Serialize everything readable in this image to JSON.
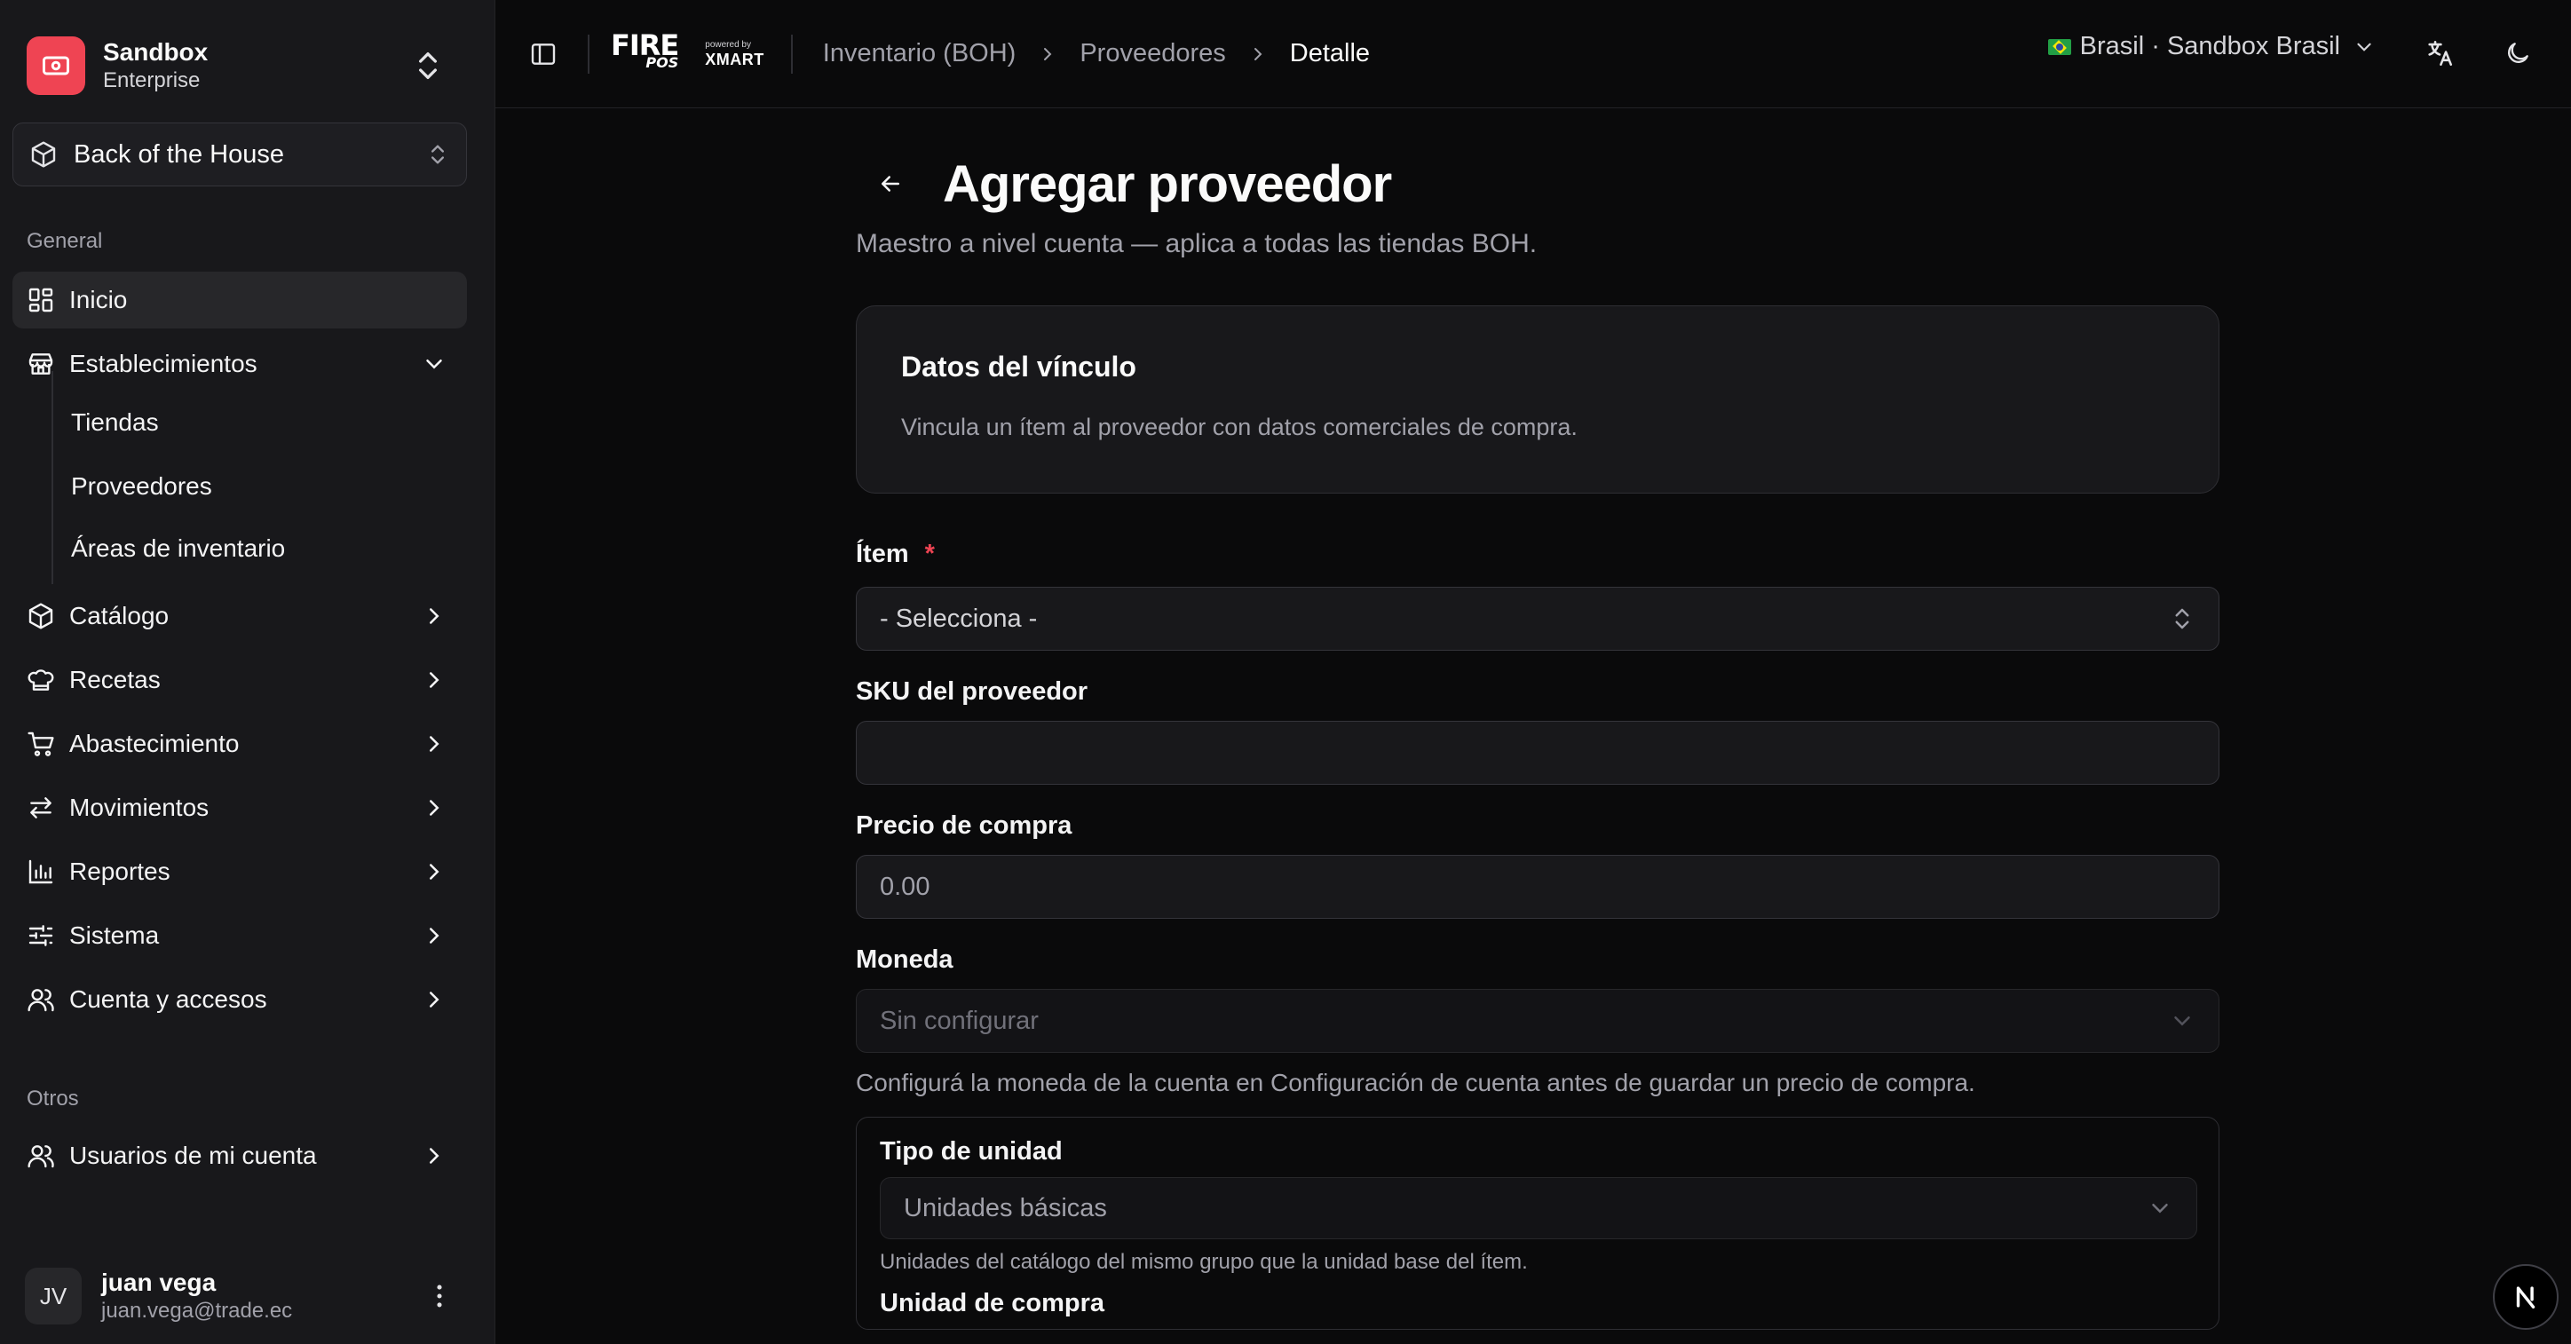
{
  "sidebar": {
    "org": {
      "name": "Sandbox",
      "plan": "Enterprise"
    },
    "module": "Back of the House",
    "sections": {
      "general": "General",
      "others": "Otros"
    },
    "items": [
      {
        "label": "Inicio",
        "icon": "dashboard-icon"
      },
      {
        "label": "Establecimientos",
        "icon": "store-icon"
      },
      {
        "label": "Catálogo",
        "icon": "box-icon"
      },
      {
        "label": "Recetas",
        "icon": "chef-hat-icon"
      },
      {
        "label": "Abastecimiento",
        "icon": "cart-icon"
      },
      {
        "label": "Movimientos",
        "icon": "arrows-icon"
      },
      {
        "label": "Reportes",
        "icon": "bar-chart-icon"
      },
      {
        "label": "Sistema",
        "icon": "sliders-icon"
      },
      {
        "label": "Cuenta y accesos",
        "icon": "users-icon"
      },
      {
        "label": "Usuarios de mi cuenta",
        "icon": "users-icon"
      }
    ],
    "sub_items": [
      "Tiendas",
      "Proveedores",
      "Áreas de inventario"
    ],
    "user": {
      "initials": "JV",
      "name": "juan vega",
      "email": "juan.vega@trade.ec"
    }
  },
  "header": {
    "brand": {
      "fire": "FIRE",
      "pos": "POS",
      "powered": "powered by",
      "xmart": "XMART"
    },
    "breadcrumb": [
      "Inventario (BOH)",
      "Proveedores",
      "Detalle"
    ],
    "region": "Brasil · Sandbox Brasil"
  },
  "page": {
    "title": "Agregar proveedor",
    "subtitle": "Maestro a nivel cuenta — aplica a todas las tiendas BOH.",
    "card": {
      "title": "Datos del vínculo",
      "description": "Vincula un ítem al proveedor con datos comerciales de compra."
    },
    "fields": {
      "item": {
        "label": "Ítem",
        "required": "*",
        "value": "- Selecciona -"
      },
      "sku": {
        "label": "SKU del proveedor",
        "value": ""
      },
      "price": {
        "label": "Precio de compra",
        "placeholder": "0.00"
      },
      "currency": {
        "label": "Moneda",
        "value": "Sin configurar",
        "hint": "Configurá la moneda de la cuenta en Configuración de cuenta antes de guardar un precio de compra."
      },
      "unit_type": {
        "label": "Tipo de unidad",
        "value": "Unidades básicas",
        "hint": "Unidades del catálogo del mismo grupo que la unidad base del ítem."
      },
      "purchase_unit": {
        "label": "Unidad de compra"
      }
    }
  },
  "colors": {
    "accent": "#ef4453",
    "background": "#0a0a0b",
    "sidebar": "#18181b"
  }
}
